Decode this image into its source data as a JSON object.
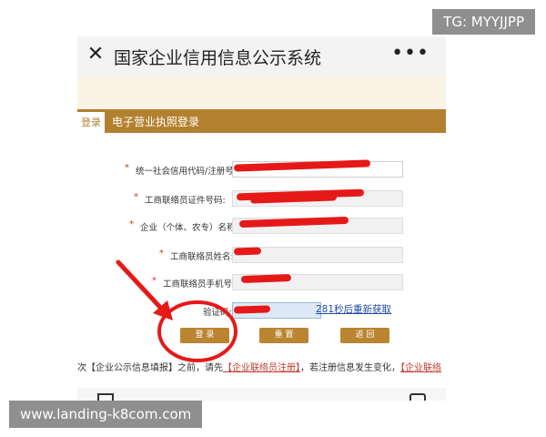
{
  "header": {
    "close_glyph": "✕",
    "title": "国家企业信用信息公示系统",
    "more_glyph": "•••"
  },
  "tabs": {
    "active_label": "登录",
    "section_label": "电子营业执照登录"
  },
  "form": {
    "required_mark": "*",
    "rows": [
      {
        "label": "统一社会信用代码/注册号:"
      },
      {
        "label": "工商联络员证件号码:"
      },
      {
        "label": "企业（个体、农专）名称:"
      },
      {
        "label": "工商联络员姓名:"
      },
      {
        "label": "工商联络员手机号:"
      }
    ],
    "captcha_label": "验证码:",
    "resend_label": "281秒后重新获取"
  },
  "buttons": {
    "login": "登 录",
    "reset": "重 置",
    "back": "返 回"
  },
  "notice": {
    "prefix": "次【企业公示信息填报】之前，请先",
    "link1": "【企业联络员注册】",
    "middle": "，若注册信息发生变化，",
    "link2": "【企业联络"
  },
  "watermarks": {
    "tg": "TG: MYYJJPP",
    "url": "www.landing-k8com.com"
  },
  "colors": {
    "tab_bar": "#b3802f",
    "button": "#b98530",
    "annotation_red": "#e61919",
    "link_blue": "#1f4aa8"
  }
}
